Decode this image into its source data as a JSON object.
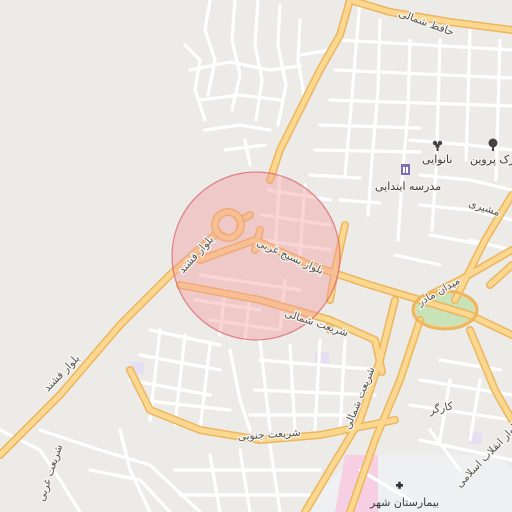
{
  "map": {
    "colors": {
      "background": "#ecebe8",
      "street": "#ffffff",
      "major_road_fill": "#fbd790",
      "major_road_casing": "#ecb65e",
      "park": "#c8e3b8",
      "hospital_area": "#f6cfe3",
      "radius_fill": "#f29b9b",
      "radius_stroke": "#d9606a"
    },
    "road_labels": {
      "bolvar_fashand_1": "بلوار فشند",
      "bolvar_fashand_2": "بلوار فشند",
      "bolvar_basij_gharbi": "بلوار بسیج غربی",
      "shariati_shomali_1": "شریعت شمالی",
      "shariati_shomali_2": "شریعت شمالی",
      "shariati_jonubi": "شریعت جنوبی",
      "shariati_gharbi": "شریعت غربی",
      "hafez_shomali": "حافظ شمالی",
      "mashiri": "مشیری",
      "meydan_mader": "میدان مادر",
      "kargar": "کارگر",
      "enghelab_eslami": "بلوار انقلاب اسلامی"
    },
    "pois": [
      {
        "label": "پارک پروین",
        "icon": "park-tree-icon"
      },
      {
        "label": "نانوایی",
        "icon": "bakery-icon"
      },
      {
        "label": "مدرسه ابتدایی",
        "icon": "school-icon"
      },
      {
        "label": "بیمارستان شهر",
        "icon": "hospital-cross-icon"
      }
    ]
  }
}
